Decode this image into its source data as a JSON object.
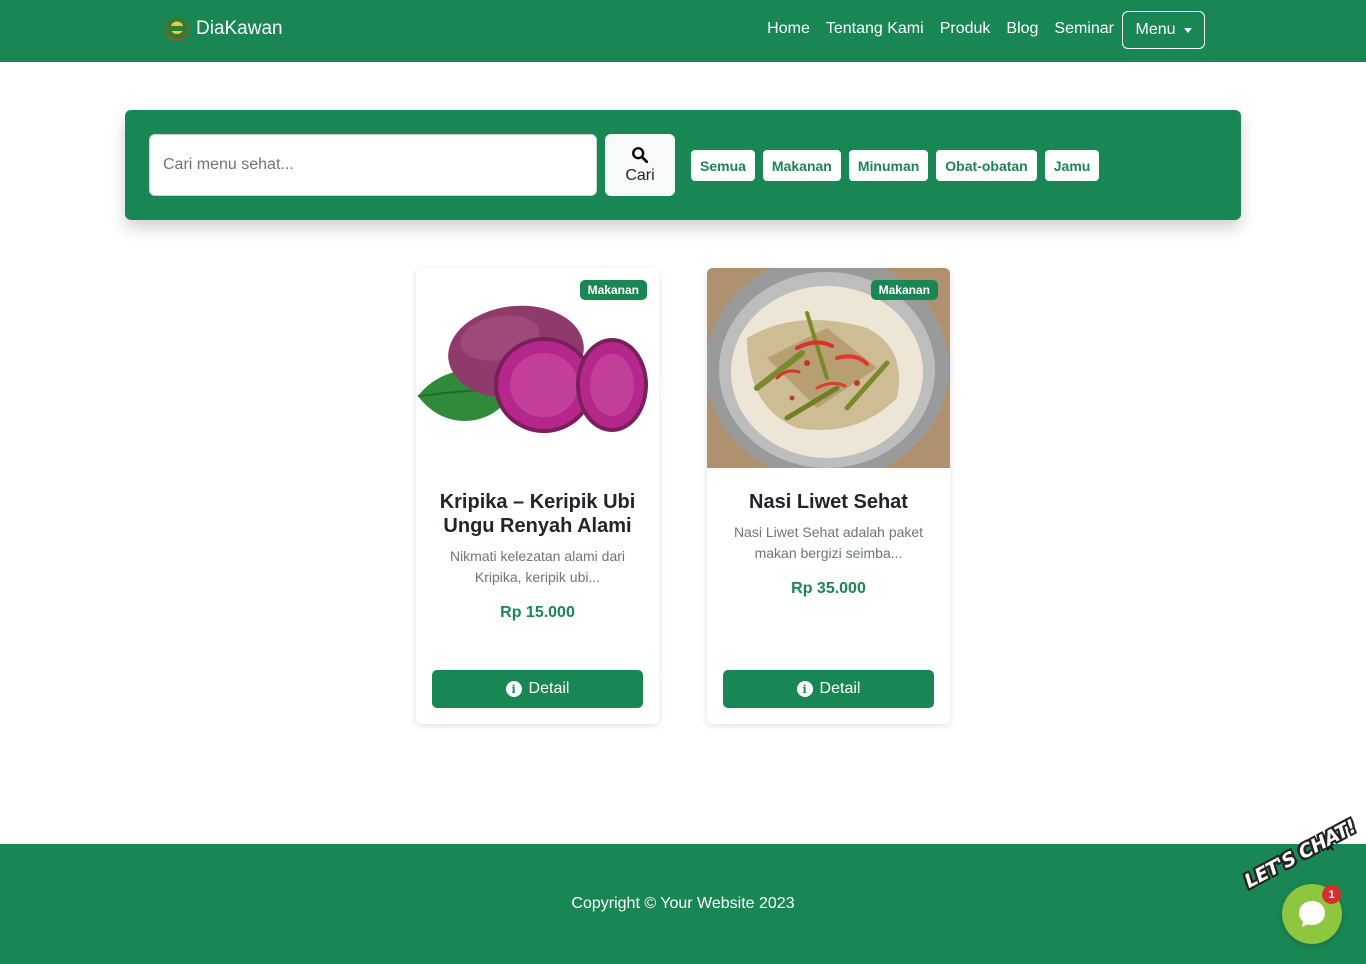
{
  "navbar": {
    "brand": "DiaKawan",
    "links": [
      "Home",
      "Tentang Kami",
      "Produk",
      "Blog",
      "Seminar"
    ],
    "menu_label": "Menu"
  },
  "search": {
    "placeholder": "Cari menu sehat...",
    "button_label": "Cari",
    "filters": [
      "Semua",
      "Makanan",
      "Minuman",
      "Obat-obatan",
      "Jamu"
    ]
  },
  "products": [
    {
      "category": "Makanan",
      "title": "Kripika – Keripik Ubi Ungu Renyah Alami",
      "description": "Nikmati kelezatan alami dari Kripika, keripik ubi...",
      "price": "Rp 15.000",
      "button_label": "Detail"
    },
    {
      "category": "Makanan",
      "title": "Nasi Liwet Sehat",
      "description": "Nasi Liwet Sehat adalah paket makan bergizi seimba...",
      "price": "Rp 35.000",
      "button_label": "Detail"
    }
  ],
  "footer": {
    "copyright": "Copyright © Your Website 2023"
  },
  "chat": {
    "label": "LET'S CHAT!",
    "unread_count": "1",
    "close_symbol": "×"
  },
  "colors": {
    "primary": "#198754",
    "chat_green": "#8dc63f",
    "notification_red": "#d32f2f"
  }
}
